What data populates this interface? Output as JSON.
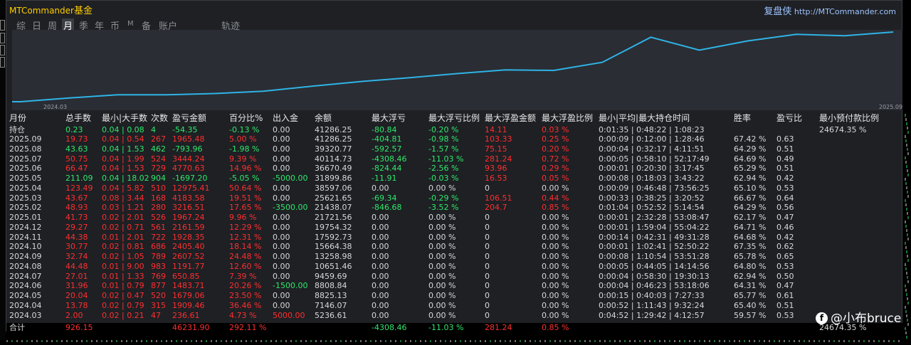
{
  "header": {
    "brand_latin": "MTCommander",
    "brand_cn": "基金",
    "right_cn": "复盘侠",
    "right_url": "http://MTCommander.com"
  },
  "tabs": [
    {
      "label": "综",
      "active": false
    },
    {
      "label": "日",
      "active": false
    },
    {
      "label": "周",
      "active": false
    },
    {
      "label": "月",
      "active": true
    },
    {
      "label": "季",
      "active": false
    },
    {
      "label": "年",
      "active": false
    },
    {
      "label": "币",
      "active": false
    },
    {
      "label": "M",
      "active": false
    },
    {
      "label": "备",
      "active": false
    },
    {
      "label": "账户",
      "active": false
    },
    {
      "label": "轨迹",
      "active": false
    }
  ],
  "chart_data": {
    "type": "line",
    "x": [
      "2024.03",
      "2024.04",
      "2024.05",
      "2024.06",
      "2024.07",
      "2024.08",
      "2024.09",
      "2024.10",
      "2024.11",
      "2024.12",
      "2025.01",
      "2025.02",
      "2025.03",
      "2025.04",
      "2025.05",
      "2025.06",
      "2025.07",
      "2025.08",
      "2025.09"
    ],
    "values": [
      5236.61,
      7146.07,
      8825.13,
      8808.84,
      9459.69,
      10651.46,
      13258.98,
      15664.38,
      17592.73,
      19754.32,
      21721.56,
      21438.07,
      25621.65,
      38597.06,
      31899.86,
      36670.49,
      40114.73,
      39320.77,
      41286.25
    ],
    "x_tick_labels": [
      "2024.03",
      "2025.09"
    ],
    "line_color": "#2fb3e6",
    "grid": false
  },
  "table": {
    "columns": [
      "月份",
      "总手数",
      "最小|大手数",
      "次数",
      "盈亏金额",
      "百分比%",
      "出入金",
      "余额",
      "最大浮亏",
      "最大浮亏比例",
      "最大浮盈金额",
      "最大浮盈比例",
      "最小|平均|最大持仓时间",
      "胜率",
      "盈亏比",
      "最小预付款比例"
    ],
    "holding": {
      "label": "持仓",
      "lots": "0.23",
      "minmax": "0.04 | 0.08",
      "count": "4",
      "pnl": "-54.35",
      "pct": "-0.13 %",
      "flow": "0.00",
      "balance": "41286.25",
      "float_loss": "-80.84",
      "float_loss_pct": "-0.20 %",
      "float_profit": "14.11",
      "float_profit_pct": "0.03 %",
      "hold_time": "0:01:35 | 0:48:22 | 1:08:23",
      "win": "",
      "pl": "",
      "margin": "24674.35 %"
    },
    "rows": [
      {
        "month": "2025.09",
        "lots": "19.73",
        "minmax": "0.04 | 0.54",
        "count": "267",
        "pnl": "1965.48",
        "pct": "5.00 %",
        "flow": "0.00",
        "balance": "41286.25",
        "float_loss": "-404.81",
        "float_loss_pct": "-0.98 %",
        "float_profit": "103.33",
        "float_profit_pct": "0.25 %",
        "hold_time": "0:00:09 | 0:12:00 | 1:28:46",
        "win": "67.42 %",
        "pl": "0.63",
        "pos": true
      },
      {
        "month": "2025.08",
        "lots": "43.63",
        "minmax": "0.04 | 1.53",
        "count": "462",
        "pnl": "-793.96",
        "pct": "-1.98 %",
        "flow": "0.00",
        "balance": "39320.77",
        "float_loss": "-592.57",
        "float_loss_pct": "-1.57 %",
        "float_profit": "75.15",
        "float_profit_pct": "0.20 %",
        "hold_time": "0:00:04 | 0:32:17 | 4:11:51",
        "win": "64.29 %",
        "pl": "0.51",
        "pos": false
      },
      {
        "month": "2025.07",
        "lots": "50.75",
        "minmax": "0.04 | 1.99",
        "count": "524",
        "pnl": "3444.24",
        "pct": "9.39 %",
        "flow": "0.00",
        "balance": "40114.73",
        "float_loss": "-4308.46",
        "float_loss_pct": "-11.03 %",
        "float_profit": "281.24",
        "float_profit_pct": "0.72 %",
        "hold_time": "0:00:05 | 0:58:10 | 52:17:49",
        "win": "64.69 %",
        "pl": "0.49",
        "pos": true
      },
      {
        "month": "2025.06",
        "lots": "66.47",
        "minmax": "0.04 | 1.53",
        "count": "729",
        "pnl": "4770.63",
        "pct": "14.96 %",
        "flow": "0.00",
        "balance": "36670.49",
        "float_loss": "-824.44",
        "float_loss_pct": "-2.56 %",
        "float_profit": "93.96",
        "float_profit_pct": "0.29 %",
        "hold_time": "0:00:01 | 0:20:30 | 3:17:45",
        "win": "65.29 %",
        "pl": "0.51",
        "pos": true
      },
      {
        "month": "2025.05",
        "lots": "211.09",
        "minmax": "0.04 | 18.02",
        "count": "904",
        "pnl": "-1697.20",
        "pct": "-5.05 %",
        "flow": "-5000.00",
        "balance": "31899.86",
        "float_loss": "-11.91",
        "float_loss_pct": "-0.03 %",
        "float_profit": "16.53",
        "float_profit_pct": "0.05 %",
        "hold_time": "0:00:08 | 0:18:03 | 3:43:22",
        "win": "62.94 %",
        "pl": "0.42",
        "pos": false
      },
      {
        "month": "2025.04",
        "lots": "123.49",
        "minmax": "0.04 | 5.82",
        "count": "510",
        "pnl": "12975.41",
        "pct": "50.64 %",
        "flow": "0.00",
        "balance": "38597.06",
        "float_loss": "0.00",
        "float_loss_pct": "0.00 %",
        "float_profit": "0",
        "float_profit_pct": "0.00 %",
        "hold_time": "0:00:09 | 0:46:48 | 73:56:25",
        "win": "65.10 %",
        "pl": "0.53",
        "pos": true
      },
      {
        "month": "2025.03",
        "lots": "43.67",
        "minmax": "0.08 | 3.44",
        "count": "168",
        "pnl": "4183.58",
        "pct": "19.51 %",
        "flow": "0.00",
        "balance": "25621.65",
        "float_loss": "-69.34",
        "float_loss_pct": "-0.29 %",
        "float_profit": "106.51",
        "float_profit_pct": "0.44 %",
        "hold_time": "0:00:33 | 0:38:25 | 3:20:52",
        "win": "66.67 %",
        "pl": "0.64",
        "pos": true
      },
      {
        "month": "2025.02",
        "lots": "48.93",
        "minmax": "0.03 | 1.21",
        "count": "280",
        "pnl": "3216.51",
        "pct": "17.65 %",
        "flow": "-3500.00",
        "balance": "21438.07",
        "float_loss": "-846.68",
        "float_loss_pct": "-3.52 %",
        "float_profit": "204.7",
        "float_profit_pct": "0.85 %",
        "hold_time": "0:01:04 | 0:52:52 | 5:14:54",
        "win": "64.29 %",
        "pl": "0.56",
        "pos": true
      },
      {
        "month": "2025.01",
        "lots": "41.73",
        "minmax": "0.02 | 2.01",
        "count": "526",
        "pnl": "1967.24",
        "pct": "9.96 %",
        "flow": "0.00",
        "balance": "21721.56",
        "float_loss": "0.00",
        "float_loss_pct": "0.00 %",
        "float_profit": "0",
        "float_profit_pct": "0.00 %",
        "hold_time": "0:00:01 | 2:32:28 | 53:08:47",
        "win": "62.17 %",
        "pl": "0.47",
        "pos": true
      },
      {
        "month": "2024.12",
        "lots": "29.27",
        "minmax": "0.02 | 0.71",
        "count": "561",
        "pnl": "2161.59",
        "pct": "12.29 %",
        "flow": "0.00",
        "balance": "19754.32",
        "float_loss": "0.00",
        "float_loss_pct": "0.00 %",
        "float_profit": "0",
        "float_profit_pct": "0.00 %",
        "hold_time": "0:00:01 | 1:59:04 | 55:04:22",
        "win": "64.71 %",
        "pl": "0.46",
        "pos": true
      },
      {
        "month": "2024.11",
        "lots": "44.38",
        "minmax": "0.01 | 2.01",
        "count": "722",
        "pnl": "1928.35",
        "pct": "12.31 %",
        "flow": "0.00",
        "balance": "17592.73",
        "float_loss": "0.00",
        "float_loss_pct": "0.00 %",
        "float_profit": "0",
        "float_profit_pct": "0.00 %",
        "hold_time": "0:00:14 | 0:42:31 | 49:31:28",
        "win": "64.68 %",
        "pl": "0.42",
        "pos": true
      },
      {
        "month": "2024.10",
        "lots": "30.77",
        "minmax": "0.02 | 0.81",
        "count": "686",
        "pnl": "2405.40",
        "pct": "18.14 %",
        "flow": "0.00",
        "balance": "15664.38",
        "float_loss": "0.00",
        "float_loss_pct": "0.00 %",
        "float_profit": "0",
        "float_profit_pct": "0.00 %",
        "hold_time": "0:00:01 | 1:02:41 | 52:50:22",
        "win": "67.35 %",
        "pl": "0.62",
        "pos": true
      },
      {
        "month": "2024.09",
        "lots": "32.74",
        "minmax": "0.02 | 1.05",
        "count": "789",
        "pnl": "2607.52",
        "pct": "24.48 %",
        "flow": "0.00",
        "balance": "13258.98",
        "float_loss": "0.00",
        "float_loss_pct": "0.00 %",
        "float_profit": "0",
        "float_profit_pct": "0.00 %",
        "hold_time": "0:00:08 | 1:10:54 | 53:51:28",
        "win": "65.78 %",
        "pl": "0.65",
        "pos": true
      },
      {
        "month": "2024.08",
        "lots": "44.48",
        "minmax": "0.01 | 9.00",
        "count": "983",
        "pnl": "1191.77",
        "pct": "12.60 %",
        "flow": "0.00",
        "balance": "10651.46",
        "float_loss": "0.00",
        "float_loss_pct": "0.00 %",
        "float_profit": "0",
        "float_profit_pct": "0.00 %",
        "hold_time": "0:00:05 | 0:44:05 | 14:14:56",
        "win": "64.80 %",
        "pl": "0.53",
        "pos": true
      },
      {
        "month": "2024.07",
        "lots": "27.01",
        "minmax": "0.01 | 1.33",
        "count": "769",
        "pnl": "650.85",
        "pct": "7.39 %",
        "flow": "0.00",
        "balance": "9459.69",
        "float_loss": "0.00",
        "float_loss_pct": "0.00 %",
        "float_profit": "0",
        "float_profit_pct": "0.00 %",
        "hold_time": "0:00:04 | 0:58:30 | 19:30:13",
        "win": "62.94 %",
        "pl": "0.50",
        "pos": true
      },
      {
        "month": "2024.06",
        "lots": "31.96",
        "minmax": "0.01 | 0.79",
        "count": "877",
        "pnl": "1483.71",
        "pct": "20.26 %",
        "flow": "-1500.00",
        "balance": "8808.84",
        "float_loss": "0.00",
        "float_loss_pct": "0.00 %",
        "float_profit": "0",
        "float_profit_pct": "0.00 %",
        "hold_time": "0:00:04 | 0:46:23 | 53:18:06",
        "win": "64.31 %",
        "pl": "0.47",
        "pos": true
      },
      {
        "month": "2024.05",
        "lots": "20.04",
        "minmax": "0.02 | 0.47",
        "count": "520",
        "pnl": "1679.06",
        "pct": "23.50 %",
        "flow": "0.00",
        "balance": "8825.13",
        "float_loss": "0.00",
        "float_loss_pct": "0.00 %",
        "float_profit": "0",
        "float_profit_pct": "0.00 %",
        "hold_time": "0:00:15 | 0:40:03 | 7:27:33",
        "win": "65.77 %",
        "pl": "0.61",
        "pos": true
      },
      {
        "month": "2024.04",
        "lots": "13.78",
        "minmax": "0.02 | 0.79",
        "count": "315",
        "pnl": "1909.46",
        "pct": "36.46 %",
        "flow": "0.00",
        "balance": "7146.07",
        "float_loss": "0.00",
        "float_loss_pct": "0.00 %",
        "float_profit": "0",
        "float_profit_pct": "0.00 %",
        "hold_time": "0:00:52 | 1:11:43 | 9:32:24",
        "win": "65.40 %",
        "pl": "0.51",
        "pos": true
      },
      {
        "month": "2024.03",
        "lots": "2.00",
        "minmax": "0.02 | 0.21",
        "count": "47",
        "pnl": "236.61",
        "pct": "4.73 %",
        "flow": "5000.00",
        "balance": "5236.61",
        "float_loss": "0.00",
        "float_loss_pct": "0.00 %",
        "float_profit": "0",
        "float_profit_pct": "0.00 %",
        "hold_time": "0:04:52 | 1:29:42 | 4:12:57",
        "win": "59.57 %",
        "pl": "0.53",
        "pos": true
      }
    ],
    "total": {
      "label": "合计",
      "lots": "926.15",
      "pnl": "46231.90",
      "pct": "292.11 %",
      "float_loss": "-4308.46",
      "float_loss_pct": "-11.03 %",
      "float_profit": "281.24",
      "float_profit_pct": "0.85 %",
      "margin": "24674.35 %"
    }
  },
  "watermark": {
    "text": "@小布bruce"
  },
  "colors": {
    "green": "#2ee86a",
    "red": "#ff2e2e",
    "accent": "#ffcc00",
    "line": "#2fb3e6"
  }
}
